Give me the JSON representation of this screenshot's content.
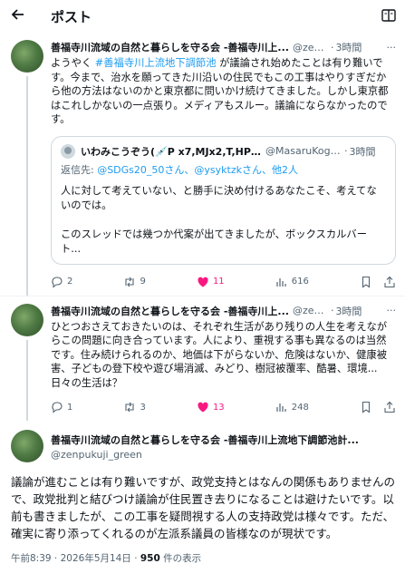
{
  "header": {
    "back_icon": "back-arrow-icon",
    "title": "ポスト",
    "reader_icon": "reader-mode-icon"
  },
  "post1": {
    "name": "善福寺川流域の自然と暮らしを守る会 -善福寺川上...",
    "handle": "@zen...",
    "time": "3時間",
    "text_prefix": "ようやく ",
    "hashtag": "#善福寺川上流地下調節池",
    "text_rest": " が議論され始めたことは有り難いです。今まで、治水を願ってきた川沿いの住民でもこの工事はやりすぎだから他の方法はないのかと東京都に問いかけ続けてきました。しかし東京都はこれしかないの一点張り。メディアもスルー。議論にならなかったのです。",
    "quote": {
      "name": "いわみこうぞう(💉P x7,MJx2,T,HPV他1...",
      "handle": "@MasaruKoga...",
      "time": "3時間",
      "reply_prefix": "返信先: ",
      "reply_to": "@SDGs20_50さん、@ysyktzkさん、他2人",
      "para1": "人に対して考えていない、と勝手に決め付けるあなたこそ、考えてないのでは。",
      "para2": "このスレッドでは幾つか代案が出てきましたが、ボックスカルバート..."
    },
    "actions": {
      "replies": "2",
      "reposts": "9",
      "likes": "11",
      "views": "616"
    }
  },
  "post2": {
    "name": "善福寺川流域の自然と暮らしを守る会 -善福寺川上...",
    "handle": "@zen...",
    "time": "3時間",
    "text": "ひとつおさえておきたいのは、それぞれ生活があり残りの人生を考えながらこの問題に向き合っています。人により、重視する事も異なるのは当然です。住み続けられるのか、地価は下がらないか、危険はないか、健康被害、子どもの登下校や遊び場消滅、みどり、樹冠被覆率、酷暑、環境...日々の生活は？",
    "actions": {
      "replies": "1",
      "reposts": "3",
      "likes": "13",
      "views": "248"
    }
  },
  "focus": {
    "name": "善福寺川流域の自然と暮らしを守る会 -善福寺川上流地下調節池計...",
    "handle": "@zenpukuji_green",
    "text": "議論が進むことは有り難いですが、政党支持とはなんの関係もありませんので、政党批判と結びつけ議論が住民置き去りになることは避けたいです。以前も書きましたが、この工事を疑問視する人の支持政党は様々です。ただ、確実に寄り添ってくれるのが左派系議員の皆様なのが現状です。",
    "time": "午前8:39 · 2026年5月14日 · ",
    "views": "950",
    "views_suffix": " 件の表示"
  },
  "colors": {
    "accent": "#1d9bf0",
    "like": "#f91880",
    "muted": "#536471"
  }
}
